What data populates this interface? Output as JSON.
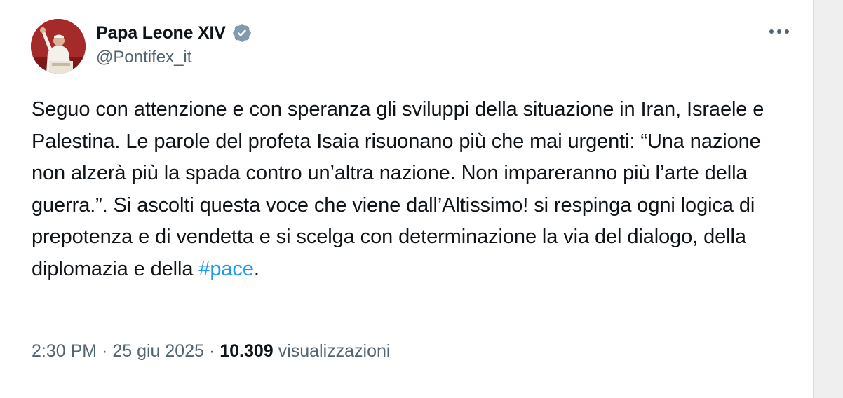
{
  "author": {
    "display_name": "Papa Leone XIV",
    "handle": "@Pontifex_it",
    "verified": true,
    "avatar_icon": "pope-avatar"
  },
  "tweet": {
    "text": "Seguo con attenzione e con speranza gli sviluppi della situazione in Iran, Israele e Palestina. Le parole del profeta Isaia risuonano più che mai urgenti: “Una nazione non alzerà più la spada contro un’altra nazione. Non impareranno più l’arte della guerra.”. Si ascolti questa voce che viene dall’Altissimo! si respinga ogni logica di prepotenza e di vendetta e si scelga con determinazione la via del dialogo, della diplomazia e della ",
    "hashtag": "#pace",
    "text_end": "."
  },
  "meta": {
    "time": "2:30 PM",
    "sep1": " · ",
    "date": "25 giu 2025",
    "sep2": " · ",
    "views_count": "10.309",
    "views_label": " visualizzazioni"
  },
  "colors": {
    "text": "#0f1419",
    "secondary": "#536471",
    "link": "#1d9bf0",
    "verified_badge": "#829aab"
  },
  "icons": {
    "more": "more-horizontal-icon",
    "verified": "verified-badge-icon"
  }
}
